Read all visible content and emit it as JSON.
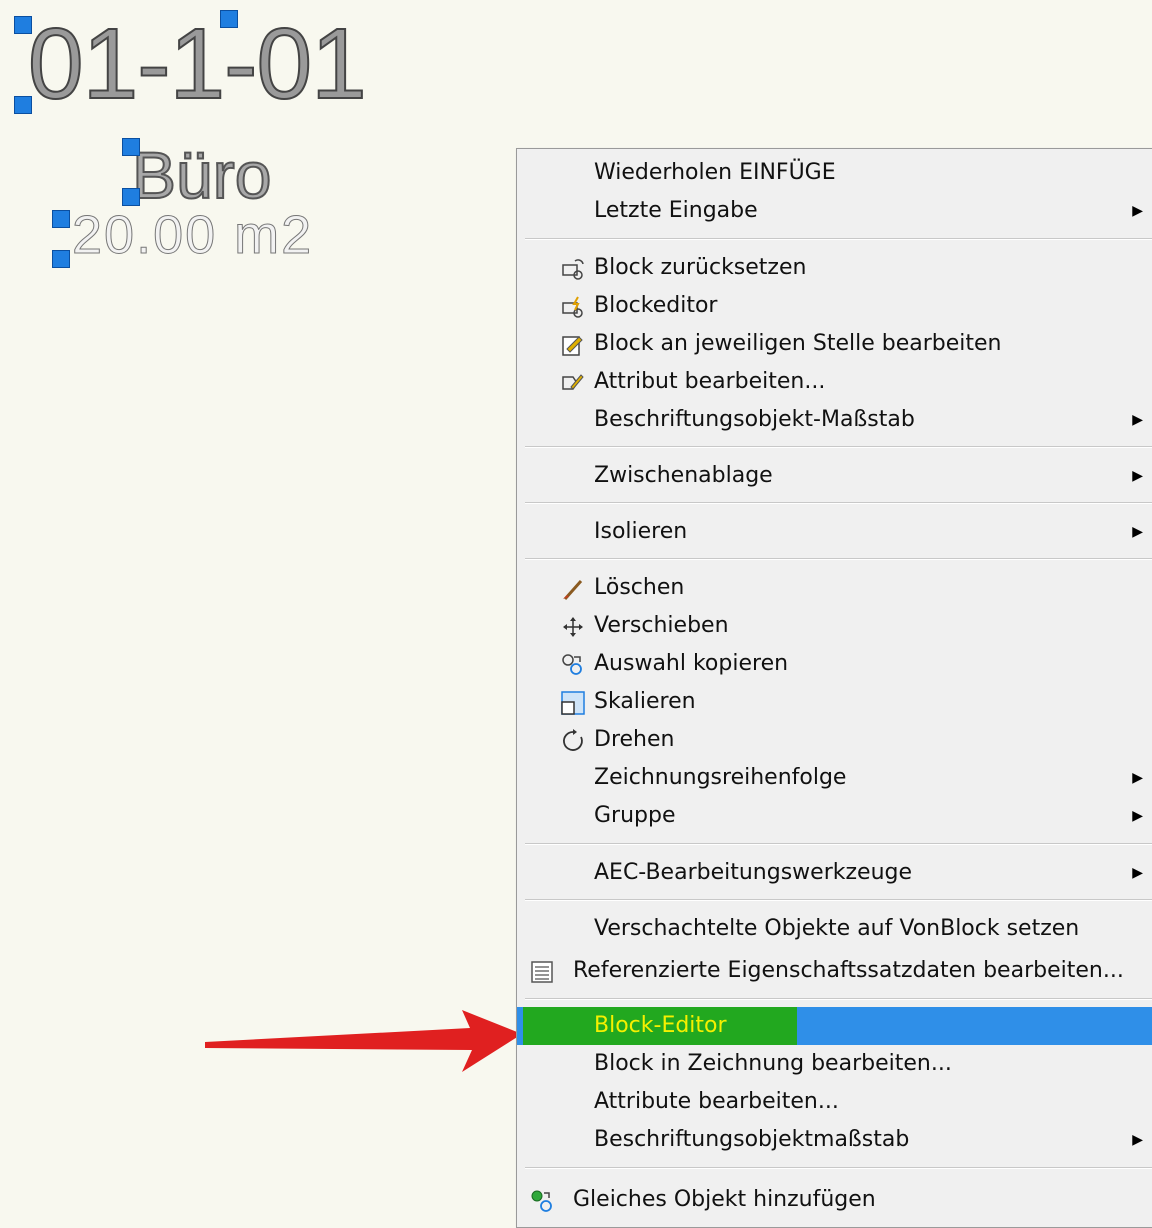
{
  "drawing": {
    "room_number": "01-1-01",
    "room_name": "Büro",
    "room_area": "20.00  m2"
  },
  "colors": {
    "grip": "#1f7ee0",
    "highlight_blue": "#2f8fe8",
    "highlight_green": "#22a81f",
    "highlight_text": "#f5f000",
    "arrow": "#e02020"
  },
  "menu": {
    "items": [
      {
        "label": "Wiederholen EINFÜGE"
      },
      {
        "label": "Letzte Eingabe",
        "submenu": "▶"
      },
      {
        "label": "Block zurücksetzen",
        "icon": "block-reset-icon"
      },
      {
        "label": "Blockeditor",
        "icon": "block-editor-icon"
      },
      {
        "label": "Block an jeweiligen Stelle bearbeiten",
        "icon": "edit-in-place-icon"
      },
      {
        "label": "Attribut bearbeiten...",
        "icon": "edit-attribute-icon"
      },
      {
        "label": "Beschriftungsobjekt-Maßstab",
        "submenu": "▶"
      },
      {
        "label": "Zwischenablage",
        "submenu": "▶"
      },
      {
        "label": "Isolieren",
        "submenu": "▶"
      },
      {
        "label": "Löschen",
        "icon": "eraser-icon"
      },
      {
        "label": "Verschieben",
        "icon": "move-icon"
      },
      {
        "label": "Auswahl kopieren",
        "icon": "copy-icon"
      },
      {
        "label": "Skalieren",
        "icon": "scale-icon"
      },
      {
        "label": "Drehen",
        "icon": "rotate-icon"
      },
      {
        "label": "Zeichnungsreihenfolge",
        "submenu": "▶"
      },
      {
        "label": "Gruppe",
        "submenu": "▶"
      },
      {
        "label": "AEC-Bearbeitungswerkzeuge",
        "submenu": "▶"
      },
      {
        "label": "Verschachtelte Objekte auf VonBlock setzen"
      },
      {
        "label": "Referenzierte Eigenschaftssatzdaten bearbeiten...",
        "icon": "property-set-icon"
      },
      {
        "label": "Block-Editor"
      },
      {
        "label": "Block in Zeichnung bearbeiten..."
      },
      {
        "label": "Attribute bearbeiten..."
      },
      {
        "label": "Beschriftungsobjektmaßstab",
        "submenu": "▶"
      },
      {
        "label": "Gleiches Objekt hinzufügen",
        "icon": "add-selected-icon"
      }
    ]
  }
}
